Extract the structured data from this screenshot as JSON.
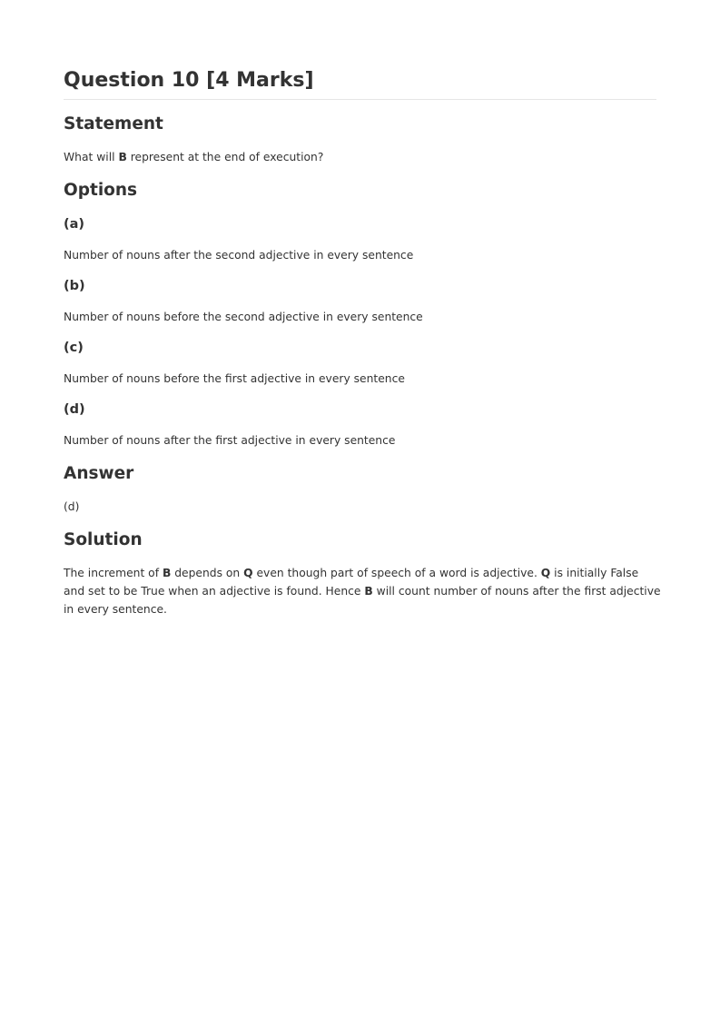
{
  "title": "Question 10 [4 Marks]",
  "statement": {
    "heading": "Statement",
    "parts": [
      "What will ",
      "B",
      " represent at the end of execution?"
    ]
  },
  "options": {
    "heading": "Options",
    "items": [
      {
        "label": "(a)",
        "text": "Number of nouns after the second adjective in every sentence"
      },
      {
        "label": "(b)",
        "text": "Number of nouns before the second adjective in every sentence"
      },
      {
        "label": "(c)",
        "text": "Number of nouns before the first adjective in every sentence"
      },
      {
        "label": "(d)",
        "text": "Number of nouns after the first adjective in every sentence"
      }
    ]
  },
  "answer": {
    "heading": "Answer",
    "value": "(d)"
  },
  "solution": {
    "heading": "Solution",
    "parts": [
      "The increment of ",
      "B",
      " depends on ",
      "Q",
      " even though part of speech of a word is adjective. ",
      "Q",
      " is initially False and set to be True when an adjective is found. Hence ",
      "B",
      " will count number of nouns after the first adjective in every sentence."
    ]
  }
}
